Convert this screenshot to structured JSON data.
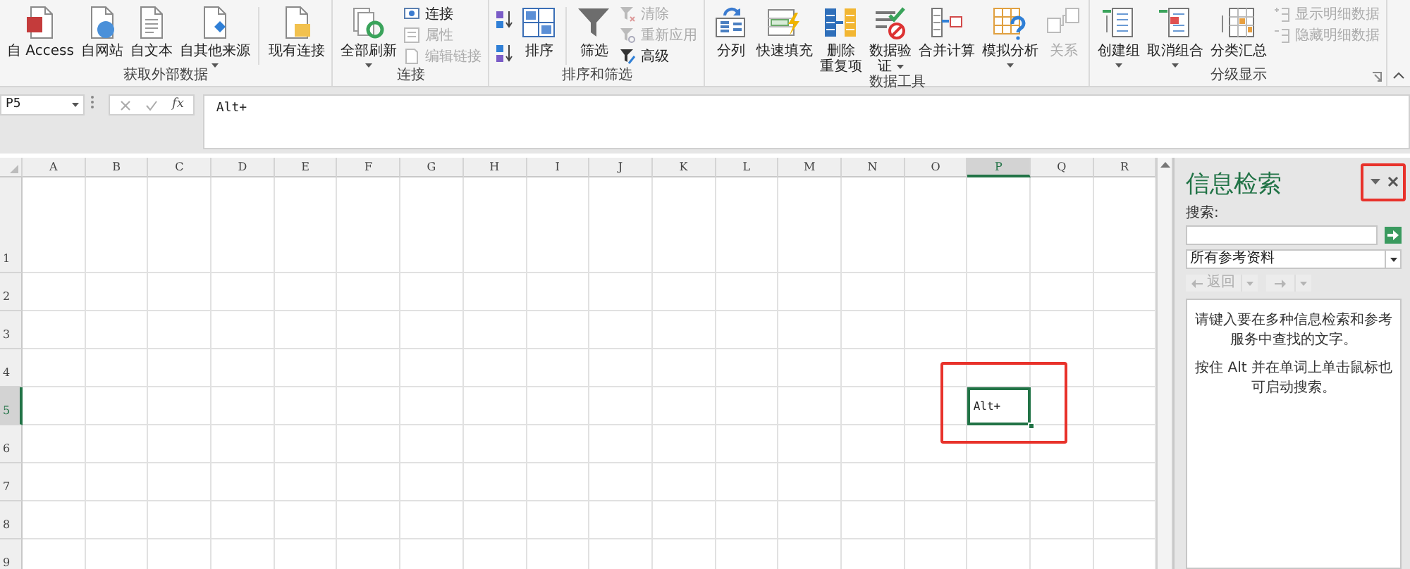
{
  "ribbon": {
    "groups": [
      {
        "label": "获取外部数据",
        "dialog_launcher": false,
        "items": [
          {
            "kind": "large",
            "lines": [
              "自 Access"
            ],
            "disabled": false,
            "dropdown": false
          },
          {
            "kind": "large",
            "lines": [
              "自网站"
            ],
            "disabled": false,
            "dropdown": false
          },
          {
            "kind": "large",
            "lines": [
              "自文本"
            ],
            "disabled": false,
            "dropdown": false
          },
          {
            "kind": "large",
            "lines": [
              "自其他来源"
            ],
            "disabled": false,
            "dropdown": true
          },
          {
            "kind": "separator"
          },
          {
            "kind": "large",
            "lines": [
              "现有连接"
            ],
            "disabled": false,
            "dropdown": false
          }
        ]
      },
      {
        "label": "连接",
        "dialog_launcher": false,
        "items": [
          {
            "kind": "large",
            "lines": [
              "全部刷新"
            ],
            "disabled": false,
            "dropdown": true
          },
          {
            "kind": "stack",
            "items": [
              {
                "label": "连接",
                "disabled": false
              },
              {
                "label": "属性",
                "disabled": true
              },
              {
                "label": "编辑链接",
                "disabled": true
              }
            ]
          }
        ]
      },
      {
        "label": "排序和筛选",
        "dialog_launcher": false,
        "items": [
          {
            "kind": "sort-buttons"
          },
          {
            "kind": "large",
            "lines": [
              "排序"
            ],
            "disabled": false,
            "dropdown": false
          },
          {
            "kind": "separator"
          },
          {
            "kind": "large",
            "lines": [
              "筛选"
            ],
            "disabled": false,
            "dropdown": false
          },
          {
            "kind": "stack",
            "items": [
              {
                "label": "清除",
                "disabled": true
              },
              {
                "label": "重新应用",
                "disabled": true
              },
              {
                "label": "高级",
                "disabled": false
              }
            ]
          }
        ]
      },
      {
        "label": "数据工具",
        "dialog_launcher": false,
        "items": [
          {
            "kind": "large",
            "lines": [
              "分列"
            ],
            "disabled": false,
            "dropdown": false
          },
          {
            "kind": "large",
            "lines": [
              "快速填充"
            ],
            "disabled": false,
            "dropdown": false
          },
          {
            "kind": "large",
            "lines": [
              "删除",
              "重复项"
            ],
            "disabled": false,
            "dropdown": false
          },
          {
            "kind": "large",
            "lines": [
              "数据验",
              "证"
            ],
            "disabled": false,
            "dropdown": true
          },
          {
            "kind": "large",
            "lines": [
              "合并计算"
            ],
            "disabled": false,
            "dropdown": false
          },
          {
            "kind": "large",
            "lines": [
              "模拟分析"
            ],
            "disabled": false,
            "dropdown": true
          },
          {
            "kind": "large",
            "lines": [
              "关系"
            ],
            "disabled": true,
            "dropdown": false
          }
        ]
      },
      {
        "label": "分级显示",
        "dialog_launcher": true,
        "items": [
          {
            "kind": "large",
            "lines": [
              "创建组"
            ],
            "disabled": false,
            "dropdown": true
          },
          {
            "kind": "large",
            "lines": [
              "取消组合"
            ],
            "disabled": false,
            "dropdown": true
          },
          {
            "kind": "large",
            "lines": [
              "分类汇总"
            ],
            "disabled": false,
            "dropdown": false
          },
          {
            "kind": "stack",
            "items": [
              {
                "label": "显示明细数据",
                "disabled": true
              },
              {
                "label": "隐藏明细数据",
                "disabled": true
              }
            ]
          }
        ]
      }
    ]
  },
  "formula_bar": {
    "name_box": "P5",
    "function_label": "fx",
    "value": "Alt+"
  },
  "sheet": {
    "columns": [
      {
        "label": "A",
        "selected": false
      },
      {
        "label": "B",
        "selected": false
      },
      {
        "label": "C",
        "selected": false
      },
      {
        "label": "D",
        "selected": false
      },
      {
        "label": "E",
        "selected": false
      },
      {
        "label": "F",
        "selected": false
      },
      {
        "label": "G",
        "selected": false
      },
      {
        "label": "H",
        "selected": false
      },
      {
        "label": "I",
        "selected": false
      },
      {
        "label": "J",
        "selected": false
      },
      {
        "label": "K",
        "selected": false
      },
      {
        "label": "L",
        "selected": false
      },
      {
        "label": "M",
        "selected": false
      },
      {
        "label": "N",
        "selected": false
      },
      {
        "label": "O",
        "selected": false
      },
      {
        "label": "P",
        "selected": true
      },
      {
        "label": "Q",
        "selected": false
      },
      {
        "label": "R",
        "selected": false
      }
    ],
    "rows": [
      {
        "label": "1",
        "selected": false
      },
      {
        "label": "2",
        "selected": false
      },
      {
        "label": "3",
        "selected": false
      },
      {
        "label": "4",
        "selected": false
      },
      {
        "label": "5",
        "selected": true
      },
      {
        "label": "6",
        "selected": false
      },
      {
        "label": "7",
        "selected": false
      },
      {
        "label": "8",
        "selected": false
      },
      {
        "label": "9",
        "selected": false
      }
    ],
    "active_cell": {
      "value": "Alt+",
      "highlighted": true
    }
  },
  "research_pane": {
    "title": "信息检索",
    "controls_highlighted": true,
    "search_label": "搜索:",
    "scope": "所有参考资料",
    "back": {
      "label": "返回",
      "disabled": true
    },
    "forward": {
      "disabled": true
    },
    "messages": [
      "请键入要在多种信息检索和参考服务中查找的文字。",
      "按住 Alt 并在单词上单击鼠标也可启动搜索。"
    ]
  }
}
